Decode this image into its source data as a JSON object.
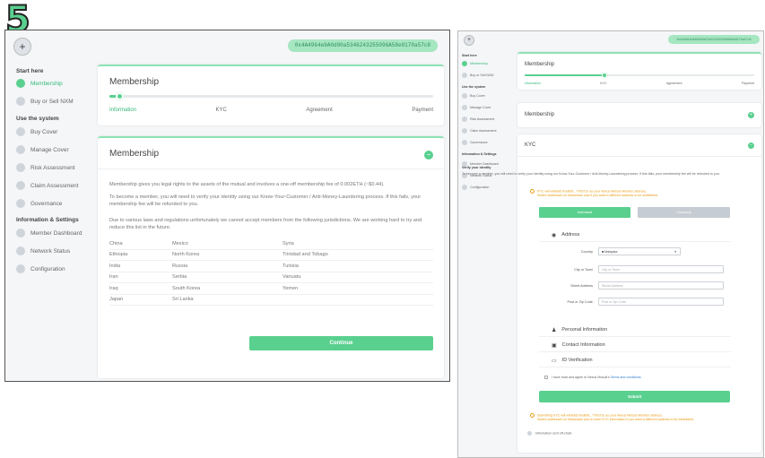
{
  "step_number": "5",
  "left": {
    "wallet_address": "0x4A4964e9A0d00a5346243255096A58e8170a57c8",
    "sidebar": {
      "start_here": "Start here",
      "membership": "Membership",
      "buy_sell": "Buy or Sell NXM",
      "use_system": "Use the system",
      "buy_cover": "Buy Cover",
      "manage_cover": "Manage Cover",
      "risk_assessment": "Risk Assessment",
      "claim_assessment": "Claim Assessment",
      "governance": "Governance",
      "info_settings": "Information & Settings",
      "member_dashboard": "Member Dashboard",
      "network_status": "Network Status",
      "configuration": "Configuration"
    },
    "progress_card": {
      "title": "Membership",
      "progress_fraction": 0.03,
      "steps": [
        "Information",
        "KYC",
        "Agreement",
        "Payment"
      ]
    },
    "membership_card": {
      "title": "Membership",
      "toggle": "−",
      "para1": "Membership gives you legal rights to the assets of the mutual and involves a one-off membership fee of 0.002ETH (~$0.44).",
      "para2": "To become a member, you will need to verify your identity using our Know-Your-Customer / Anti-Money-Laundering process. If this fails, your membership fee will be refunded to you.",
      "para3": "Due to various laws and regulations unfortunately we cannot accept members from the following jurisdictions. We are working hard to try and reduce this list in the future.",
      "jurisdictions": [
        [
          "China",
          "Mexico",
          "Syria"
        ],
        [
          "Ethiopia",
          "North Korea",
          "Trinidad and Tobago"
        ],
        [
          "India",
          "Russia",
          "Tunisia"
        ],
        [
          "Iran",
          "Serbia",
          "Vanuatu"
        ],
        [
          "Iraq",
          "South Korea",
          "Yemen"
        ],
        [
          "Japan",
          "Sri Lanka",
          ""
        ]
      ],
      "continue_label": "Continue"
    }
  },
  "right": {
    "wallet_address": "0x4A4964e9A0d00a5346243255096A58e8170a57c8",
    "sidebar": {
      "start_here": "Start here",
      "membership": "Membership",
      "buy_sell": "Buy or Sell NXM",
      "use_system": "Use the system",
      "buy_cover": "Buy Cover",
      "manage_cover": "Manage Cover",
      "risk_assessment": "Risk Assessment",
      "claim_assessment": "Claim Assessment",
      "governance": "Governance",
      "info_settings": "Information & Settings",
      "member_dashboard": "Member Dashboard",
      "network_status": "Network Status",
      "configuration": "Configuration"
    },
    "progress_card": {
      "title": "Membership",
      "progress_fraction": 0.35,
      "steps": [
        "Information",
        "KYC",
        "Agreement",
        "Payment"
      ]
    },
    "membership_collapsed": {
      "title": "Membership",
      "toggle": "+"
    },
    "kyc": {
      "title": "KYC",
      "toggle": "−",
      "verify_heading": "Verify your identity",
      "verify_text": "To become a member, you will need to verify your identity using our Know-Your-Customer / Anti-Money-Laundering process. If this fails, your membership fee will be refunded to you.",
      "warning1_line1": "KYC will whitelist 0xeB96...77bd71e as your Nexus Mutual Member address.",
      "warning1_line2": "Switch addresses on Metamask now if you want a different address to be whitelisted.",
      "tab_individual": "Individual",
      "tab_company": "Company",
      "address_title": "Address",
      "country_label": "Country",
      "country_value": "Malaysia",
      "city_label": "City or Town",
      "city_placeholder": "City or Town",
      "street_label": "Street Address",
      "street_placeholder": "Street Address",
      "post_label": "Post or Zip Code",
      "post_placeholder": "Post or Zip Code",
      "personal_info": "Personal Information",
      "contact_info": "Contact Information",
      "id_verification": "ID Verification",
      "agree_text": "I have read and agree to Nexus Mutual's",
      "terms_link": "Terms and conditions",
      "submit_label": "Submit",
      "warning2_line1": "Submitting KYC will whitelist 0xeB96...77bd71e as your Nexus Mutual Member address.",
      "warning2_line2": "Switch addresses on Metamask and re-enter KYC information if you want a different address to be whitelisted.",
      "info_note": "Information sent off-chain"
    }
  },
  "colors": {
    "accent": "#5ad08f",
    "warning": "#e89b13",
    "tab_inactive": "#c6ccd3"
  }
}
